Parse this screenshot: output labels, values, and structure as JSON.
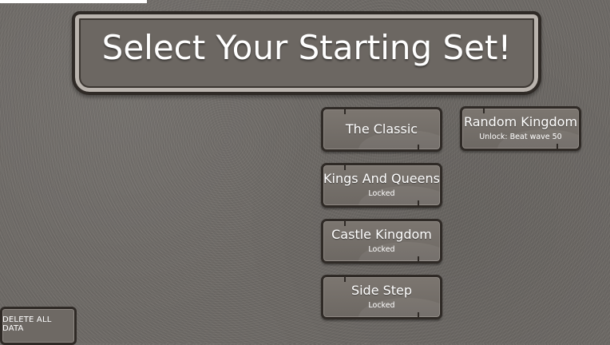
{
  "title": "Select Your Starting Set!",
  "sets": [
    {
      "name": "The Classic",
      "status": ""
    },
    {
      "name": "Kings And Queens",
      "status": "Locked"
    },
    {
      "name": "Castle Kingdom",
      "status": "Locked"
    },
    {
      "name": "Side Step",
      "status": "Locked"
    },
    {
      "name": "Random Kingdom",
      "status": "Unlock: Beat wave 50"
    }
  ],
  "delete_label": "DELETE ALL DATA"
}
